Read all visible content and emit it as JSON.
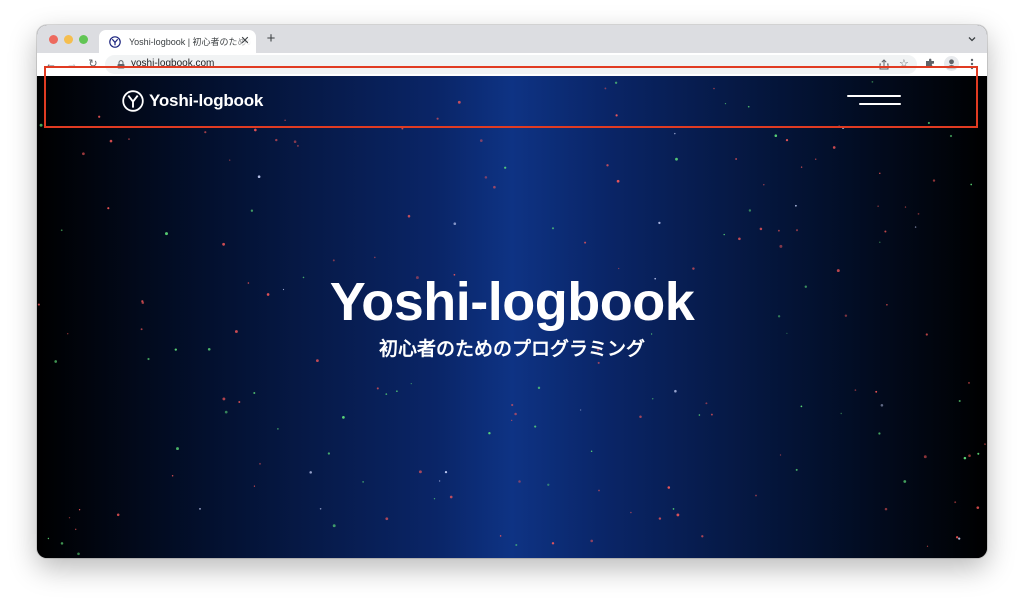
{
  "browser": {
    "tab_title": "Yoshi-logbook | 初心者のためのプログラミング",
    "tab_close_glyph": "✕",
    "new_tab_glyph": "+",
    "back_glyph": "←",
    "forward_glyph": "→",
    "reload_glyph": "↻",
    "star_glyph": "☆",
    "url": "yoshi-logbook.com",
    "icons": [
      "lock-icon",
      "share-icon",
      "star-icon",
      "extensions-icon",
      "profile-icon",
      "menu-icon",
      "tab-search-icon"
    ]
  },
  "site": {
    "logo_text": "Yoshi-logbook",
    "hero_title": "Yoshi-logbook",
    "hero_subtitle": "初心者のためのプログラミング",
    "menu_icon": "hamburger-icon"
  },
  "colors": {
    "annotation_box": "#e03b22",
    "background_center": "#0e3384",
    "background_edge": "#000000",
    "star_red": "#ff5a5a",
    "star_green": "#5fe07a"
  }
}
